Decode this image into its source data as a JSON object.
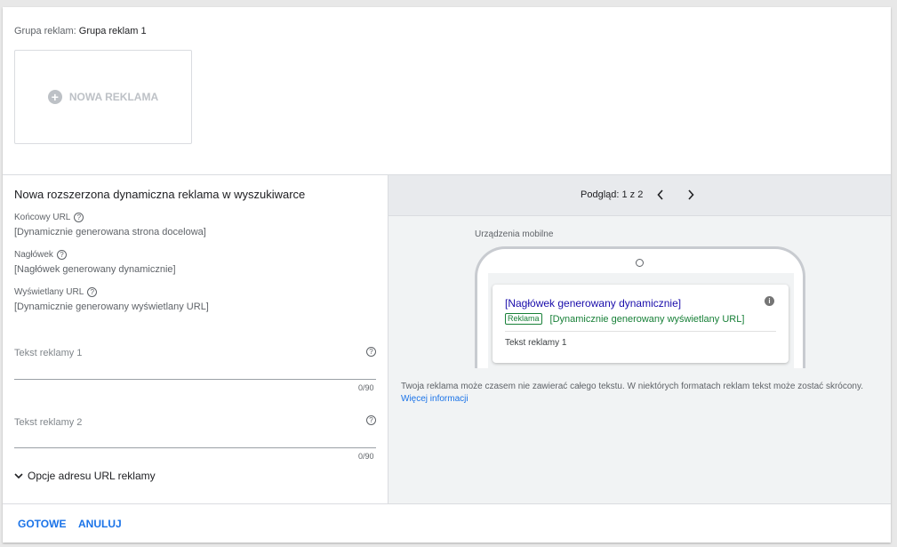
{
  "ad_group": {
    "label": "Grupa reklam:",
    "name": "Grupa reklam 1"
  },
  "new_ad": {
    "label": "NOWA REKLAMA",
    "icon": "plus-circle-icon"
  },
  "form": {
    "title": "Nowa rozszerzona dynamiczna reklama w wyszukiwarce",
    "final_url": {
      "label": "Końcowy URL",
      "value": "[Dynamicznie generowana strona docelowa]"
    },
    "headline": {
      "label": "Nagłówek",
      "value": "[Nagłówek generowany dynamicznie]"
    },
    "display_url": {
      "label": "Wyświetlany URL",
      "value": "[Dynamicznie generowany wyświetlany URL]"
    },
    "ad_text_1": {
      "label": "Tekst reklamy 1",
      "counter": "0/90"
    },
    "ad_text_2": {
      "label": "Tekst reklamy 2",
      "counter": "0/90"
    },
    "url_options": "Opcje adresu URL reklamy"
  },
  "preview": {
    "label": "Podgląd: 1 z 2",
    "device_label": "Urządzenia mobilne",
    "ad": {
      "headline": "[Nagłówek generowany dynamicznie]",
      "badge": "Reklama",
      "display_url": "[Dynamicznie generowany wyświetlany URL]",
      "text": "Tekst reklamy 1"
    },
    "notice": "Twoja reklama może czasem nie zawierać całego tekstu. W niektórych formatach reklam tekst może zostać skrócony.",
    "notice_link": "Więcej informacji"
  },
  "actions": {
    "done": "GOTOWE",
    "cancel": "ANULUJ"
  },
  "colors": {
    "accent": "#1a73e8",
    "ad_headline": "#1a0dab",
    "ad_url": "#188038"
  }
}
